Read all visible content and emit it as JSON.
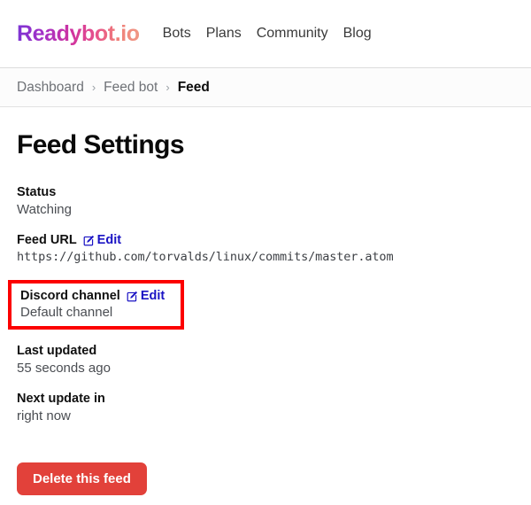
{
  "header": {
    "brand": "Readybot.io",
    "nav": [
      {
        "label": "Bots"
      },
      {
        "label": "Plans"
      },
      {
        "label": "Community"
      },
      {
        "label": "Blog"
      }
    ]
  },
  "breadcrumb": {
    "separator": "›",
    "items": [
      {
        "label": "Dashboard",
        "current": false
      },
      {
        "label": "Feed bot",
        "current": false
      },
      {
        "label": "Feed",
        "current": true
      }
    ]
  },
  "main": {
    "page_title": "Feed Settings",
    "edit_label": "Edit",
    "edit_icon": "edit-pencil-square-icon",
    "fields": [
      {
        "label": "Status",
        "value": "Watching",
        "editable": false,
        "mono": false,
        "highlighted": false
      },
      {
        "label": "Feed URL",
        "value": "https://github.com/torvalds/linux/commits/master.atom",
        "editable": true,
        "mono": true,
        "highlighted": false
      },
      {
        "label": "Discord channel",
        "value": "Default channel",
        "editable": true,
        "mono": false,
        "highlighted": true
      },
      {
        "label": "Last updated",
        "value": "55 seconds ago",
        "editable": false,
        "mono": false,
        "highlighted": false
      },
      {
        "label": "Next update in",
        "value": "right now",
        "editable": false,
        "mono": false,
        "highlighted": false
      }
    ],
    "delete_button": "Delete this feed"
  },
  "colors": {
    "brand_gradient_start": "#7b34d4",
    "brand_gradient_end": "#f09a86",
    "link_blue": "#1a13c4",
    "danger_red": "#e2413a",
    "highlight_red": "#fc0000"
  }
}
